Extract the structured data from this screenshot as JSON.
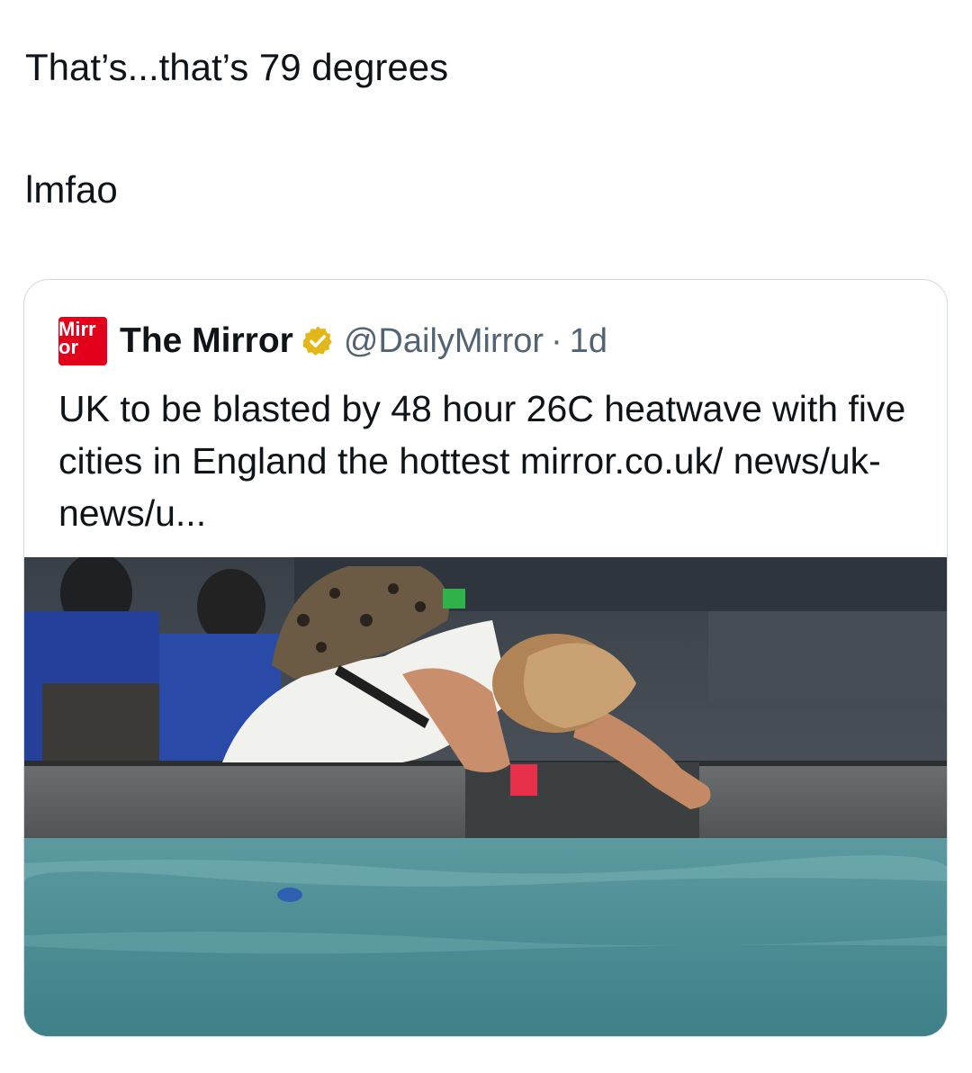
{
  "post": {
    "line1": "That’s...that’s 79 degrees",
    "line2": "lmfao"
  },
  "quote": {
    "avatar_text_top": "Mirr",
    "avatar_text_bottom": "or",
    "author_name": "The Mirror",
    "handle": "@DailyMirror",
    "separator": "·",
    "timestamp": "1d",
    "body": "UK to be blasted by 48 hour 26C heatwave with five cities in England the hottest mirror.co.uk/ news/uk-news/u..."
  },
  "icons": {
    "verified": "verified-badge-icon"
  },
  "colors": {
    "text": "#0f1419",
    "muted": "#536471",
    "border": "#cfd9de",
    "brand_red": "#e2001a",
    "verified_gold": "#e2b719"
  }
}
